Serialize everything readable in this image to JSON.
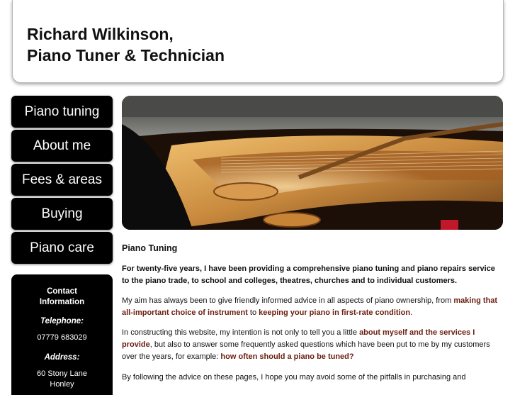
{
  "header": {
    "title_line1": "Richard Wilkinson,",
    "title_line2": "Piano Tuner & Technician"
  },
  "nav": [
    {
      "label": "Piano tuning"
    },
    {
      "label": "About me"
    },
    {
      "label": "Fees & areas"
    },
    {
      "label": "Buying"
    },
    {
      "label": "Piano care"
    }
  ],
  "contact": {
    "heading_line1": "Contact",
    "heading_line2": "Information",
    "telephone_label": "Telephone:",
    "telephone": "07779 683029",
    "address_label": "Address:",
    "address_line1": "60 Stony Lane",
    "address_line2": "Honley"
  },
  "main": {
    "heading": "Piano Tuning",
    "intro": "For twenty-five years, I have been providing a comprehensive piano tuning and piano repairs service to the piano trade, to school and colleges, theatres, churches and to individual customers.",
    "p2_text1": "My aim has always been to give friendly informed advice in all aspects of piano ownership, from ",
    "p2_link1": "making that all-important choice of instrument",
    "p2_text2": " to ",
    "p2_link2": "keeping your piano in first-rate condition",
    "p2_text3": ".",
    "p3_text1": "In constructing this website, my intention is not only to tell you a little ",
    "p3_link1": "about myself and the services I provide",
    "p3_text2": ", but also to answer some frequently asked questions which have been put to me by my customers over the years, for example: ",
    "p3_link2": "how often should a piano be tuned?",
    "p4_text1": "By following the advice on these pages, I hope you may avoid some of the pitfalls in purchasing and"
  },
  "colors": {
    "nav_background": "#000000",
    "link": "#6b1e10"
  }
}
